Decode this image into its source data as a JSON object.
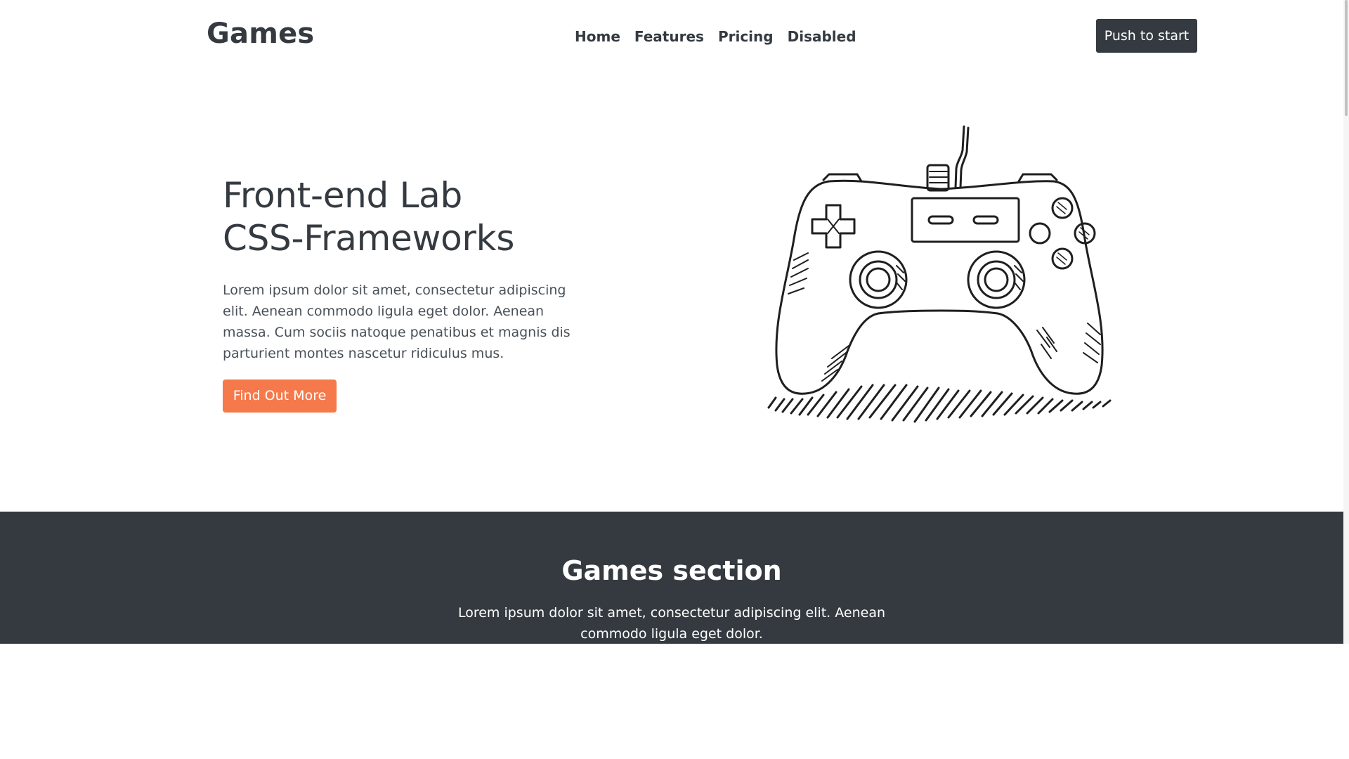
{
  "header": {
    "logo": "Games",
    "nav": [
      {
        "label": "Home"
      },
      {
        "label": "Features"
      },
      {
        "label": "Pricing"
      },
      {
        "label": "Disabled"
      }
    ],
    "cta_label": "Push to start"
  },
  "hero": {
    "title_line1": "Front-end Lab",
    "title_line2": "CSS-Frameworks",
    "text": "Lorem ipsum dolor sit amet, consectetur adipiscing elit. Aenean commodo ligula eget dolor. Aenean massa. Cum sociis natoque penatibus et magnis dis parturient montes nascetur ridiculus mus.",
    "button_label": "Find Out More",
    "illustration_icon": "gamepad-icon"
  },
  "games_section": {
    "title": "Games section",
    "text": "Lorem ipsum dolor sit amet, consectetur adipiscing elit. Aenean commodo ligula eget dolor."
  },
  "colors": {
    "dark": "#343a40",
    "accent": "#f5794b",
    "background": "#ffffff"
  }
}
